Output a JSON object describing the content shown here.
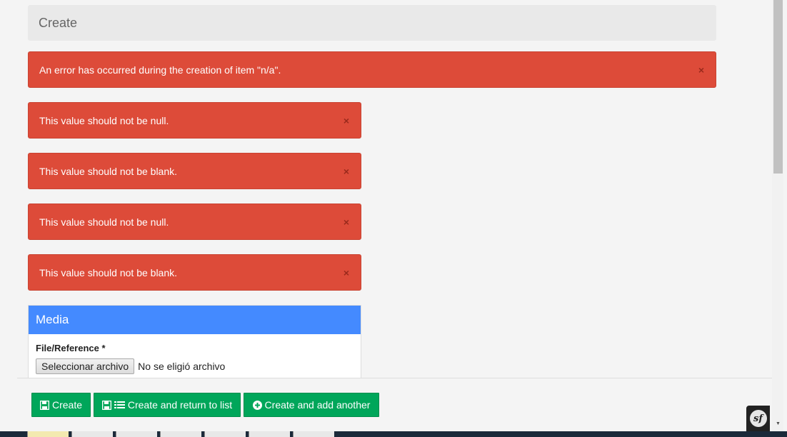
{
  "header": {
    "title": "Create"
  },
  "alerts": {
    "main": "An error has occurred during the creation of item \"n/a\".",
    "field_errors": [
      "This value should not be null.",
      "This value should not be blank.",
      "This value should not be null.",
      "This value should not be blank."
    ],
    "close_glyph": "×"
  },
  "media": {
    "title": "Media",
    "field_label": "File/Reference *",
    "file_button": "Seleccionar archivo",
    "file_status": "No se eligió archivo"
  },
  "actions": {
    "create": "Create",
    "create_return": "Create and return to list",
    "create_another": "Create and add another"
  },
  "debug_toolbar": {
    "logo_text": "sf"
  },
  "colors": {
    "danger": "#dd4b39",
    "success": "#00a65a",
    "primary": "#448aff"
  }
}
